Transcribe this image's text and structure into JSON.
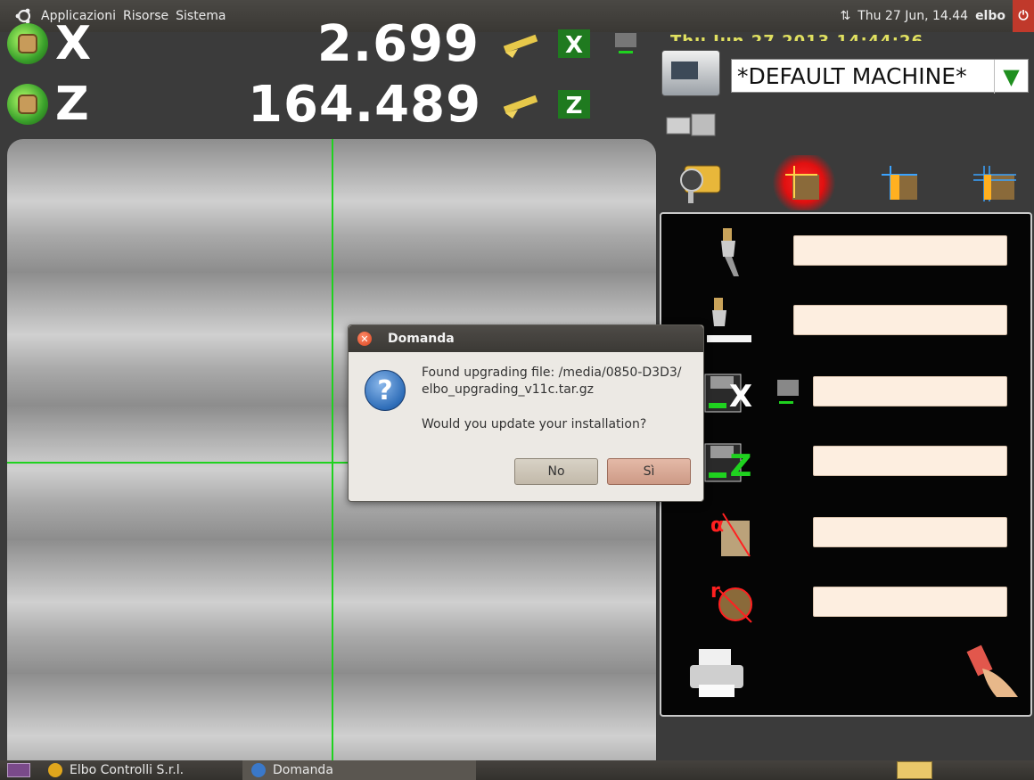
{
  "top_panel": {
    "menu": [
      "Applicazioni",
      "Risorse",
      "Sistema"
    ],
    "clock": "Thu 27 Jun, 14.44",
    "user": "elbo"
  },
  "axes": [
    {
      "letter": "X",
      "value": "2.699"
    },
    {
      "letter": "Z",
      "value": "164.489"
    }
  ],
  "machine": {
    "date_partial": "Thu Jun 27 2013 14:44:26",
    "selected": "*DEFAULT MACHINE*",
    "arrow": "▼"
  },
  "dialog": {
    "title": "Domanda",
    "line1": "Found upgrading file: /media/0850-D3D3/",
    "line2": "elbo_upgrading_v11c.tar.gz",
    "question": "Would you update your installation?",
    "no_label": "No",
    "yes_label": "Sì",
    "icon": "?"
  },
  "taskbar": {
    "items": [
      "Elbo Controlli S.r.l.",
      "Domanda"
    ]
  },
  "colors": {
    "crosshair": "#1fd21f",
    "field_bg": "#fdeee0",
    "active_mode": "#e01010"
  }
}
